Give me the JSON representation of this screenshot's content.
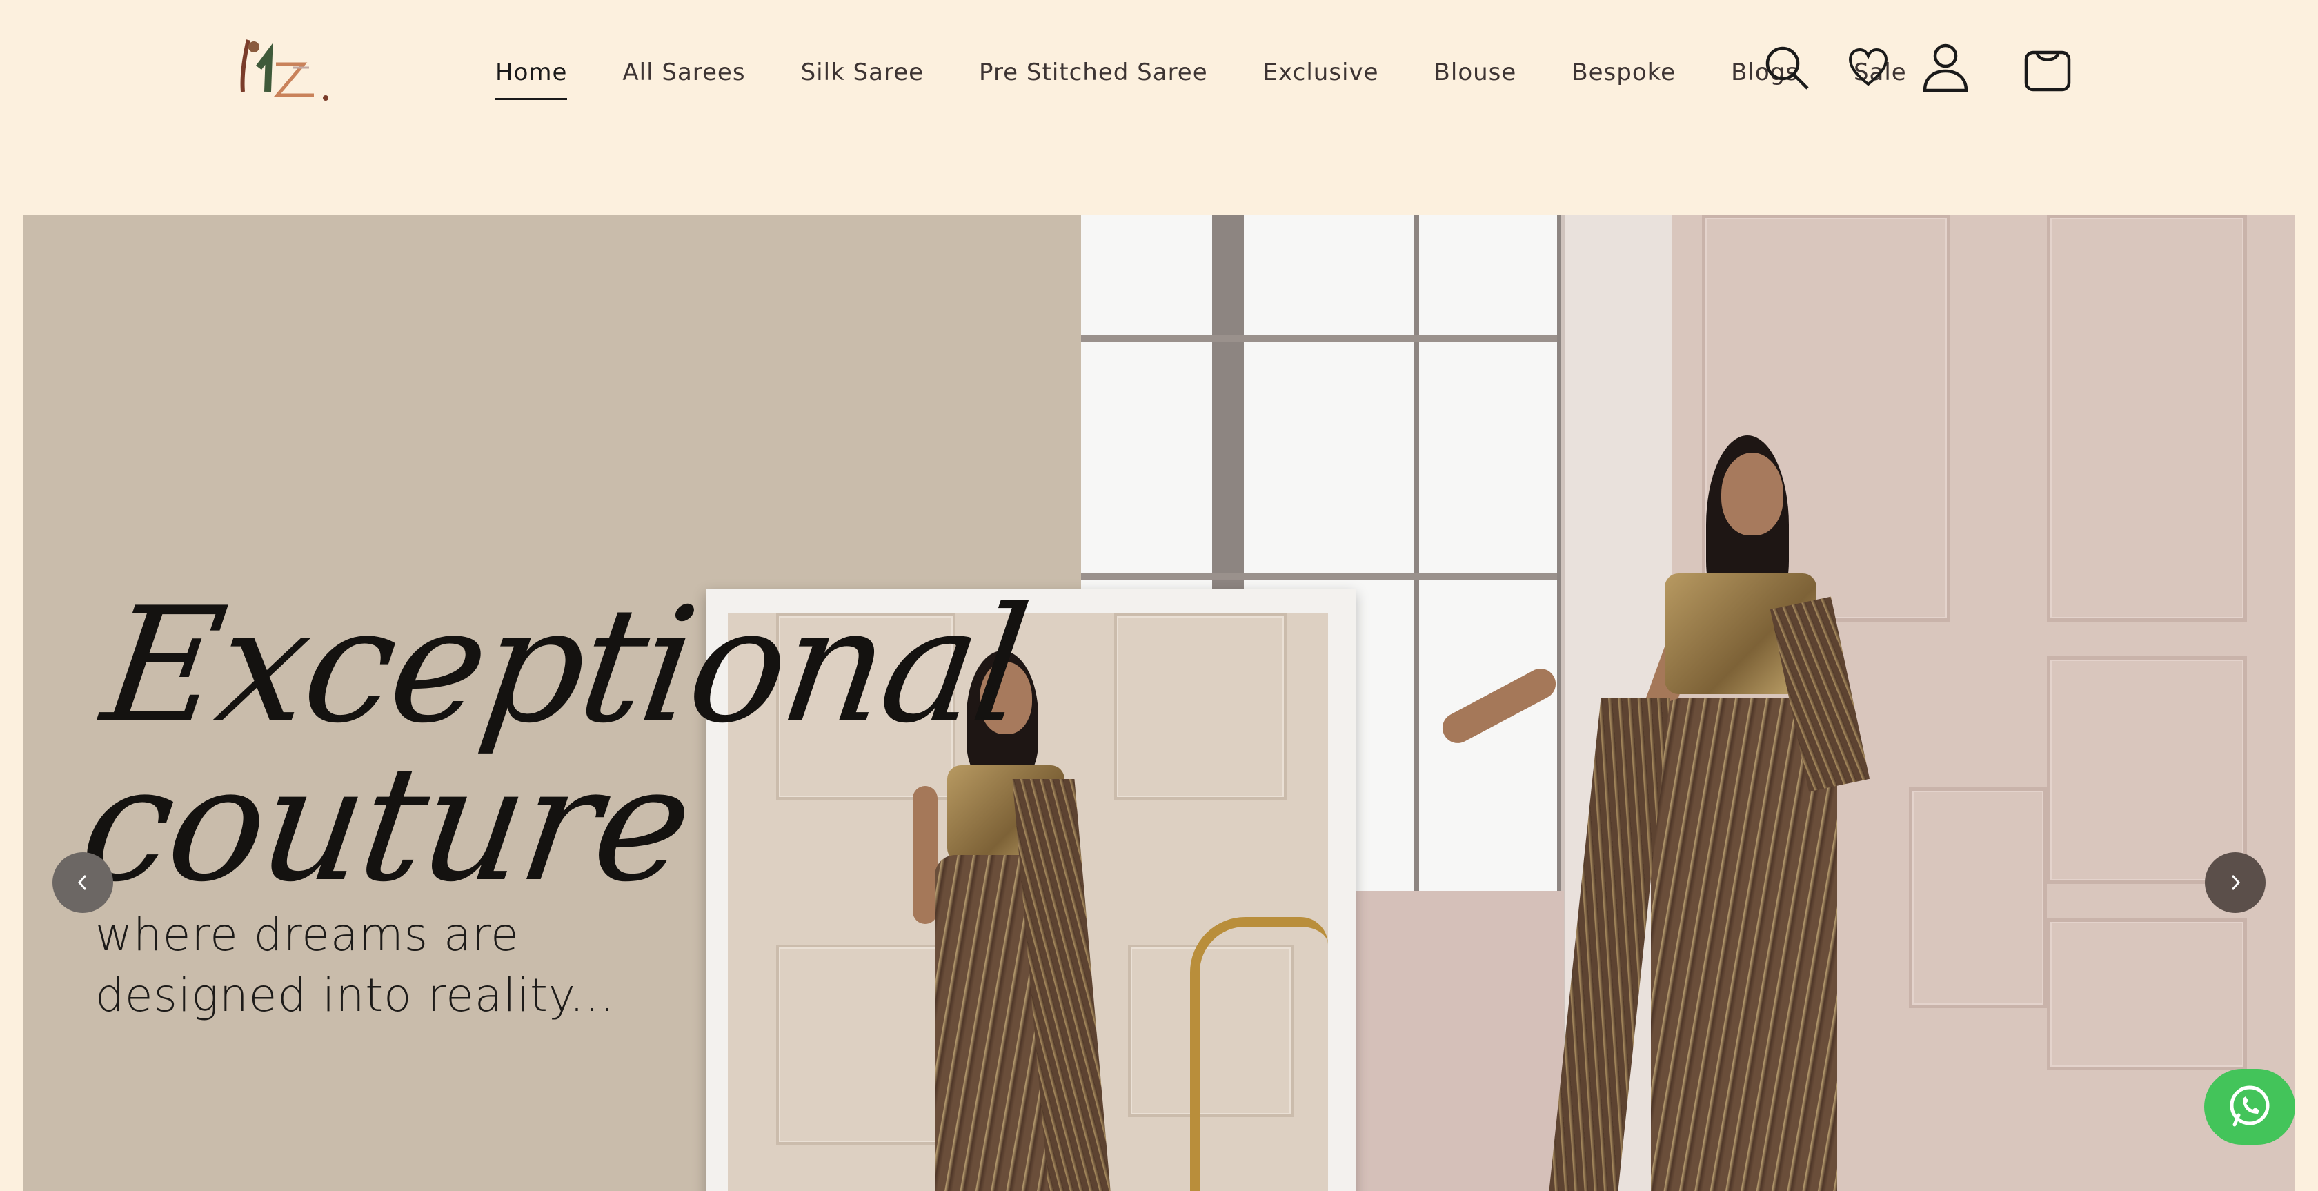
{
  "header": {
    "logo_text": "KZ",
    "nav": [
      {
        "label": "Home",
        "active": true
      },
      {
        "label": "All Sarees",
        "active": false
      },
      {
        "label": "Silk Saree",
        "active": false
      },
      {
        "label": "Pre Stitched Saree",
        "active": false
      },
      {
        "label": "Exclusive",
        "active": false
      },
      {
        "label": "Blouse",
        "active": false
      },
      {
        "label": "Bespoke",
        "active": false
      },
      {
        "label": "Blogs",
        "active": false
      },
      {
        "label": "Sale",
        "active": false
      }
    ],
    "icons": {
      "search": "search-icon",
      "wishlist": "heart-icon",
      "account": "user-icon",
      "cart": "bag-icon"
    }
  },
  "hero": {
    "title": "Exceptional couture",
    "subtitle_line1": "where dreams are",
    "subtitle_line2": "designed into reality..."
  },
  "controls": {
    "prev_icon": "chevron-left-icon",
    "next_icon": "chevron-right-icon",
    "chat_icon": "whatsapp-icon"
  },
  "colors": {
    "background": "#fcf0de",
    "hero_left": "#c9bcab",
    "whatsapp": "#43c45a",
    "text": "#2a2220"
  }
}
